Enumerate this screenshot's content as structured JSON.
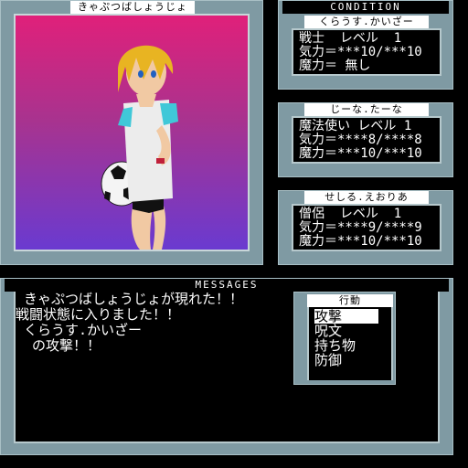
{
  "enemy_panel": {
    "title": "きゃぷつばしょうじょ"
  },
  "condition": {
    "title": "CONDITION",
    "party": [
      {
        "name": "くらうす.かいざー",
        "lines": [
          "戦士  レベル  1",
          "気力＝***10/***10",
          "魔力＝ 無し"
        ]
      },
      {
        "name": "じーな.たーな",
        "lines": [
          "魔法使い レベル 1",
          "気力＝****8/****8",
          "魔力＝***10/***10"
        ]
      },
      {
        "name": "せしる.えおりあ",
        "lines": [
          "僧侶  レベル  1",
          "気力＝****9/****9",
          "魔力＝***10/***10"
        ]
      }
    ]
  },
  "messages": {
    "title": "MESSAGES",
    "lines": [
      " きゃぷつばしょうじょが現れた！！",
      "戦闘状態に入りました！！",
      " くらうす.かいざー",
      "  の攻撃！！"
    ]
  },
  "command_menu": {
    "title": "行動",
    "items": [
      "攻撃",
      "呪文",
      "持ち物",
      "防御"
    ],
    "selected_index": 0
  },
  "colors": {
    "panel": "#7f9aa3",
    "gradient_top": "#e0207a",
    "gradient_bottom": "#5f2fd0"
  }
}
